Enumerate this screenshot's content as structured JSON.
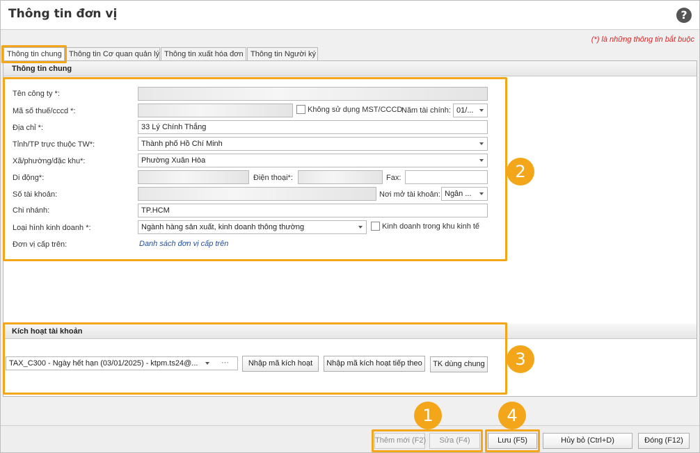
{
  "window": {
    "title": "Thông tin đơn vị",
    "help_symbol": "?"
  },
  "required_note": "(*) là những thông tin bắt buộc",
  "tabs": [
    {
      "label": "Thông tin chung",
      "active": true
    },
    {
      "label": "Thông tin Cơ quan quản lý"
    },
    {
      "label": "Thông tin xuất hóa đơn"
    },
    {
      "label": "Thông tin Người ký"
    }
  ],
  "general": {
    "section_title": "Thông tin chung",
    "company_name": {
      "label": "Tên công ty *:",
      "value": ""
    },
    "tax_code": {
      "label": "Mã số thuế/cccd *:",
      "value": ""
    },
    "no_tax_checkbox": {
      "label": "Không sử dụng MST/CCCD",
      "checked": false
    },
    "fiscal_year": {
      "label": "Năm tài chính:",
      "value": "01/..."
    },
    "address": {
      "label": "Địa chỉ *:",
      "value": "33 Lý Chính Thắng"
    },
    "province": {
      "label": "Tỉnh/TP trực thuộc TW*:",
      "value": "Thành phố Hồ Chí Minh"
    },
    "ward": {
      "label": "Xã/phường/đặc khu*:",
      "value": "Phường Xuân Hòa"
    },
    "mobile": {
      "label": "Di động*:",
      "value": ""
    },
    "phone": {
      "label": "Điện thoại*:",
      "value": ""
    },
    "fax": {
      "label": "Fax:",
      "value": ""
    },
    "account_no": {
      "label": "Số tài khoản:",
      "value": ""
    },
    "bank": {
      "label": "Nơi mở tài khoản:",
      "value": "Ngân ..."
    },
    "branch": {
      "label": "Chi nhánh:",
      "value": "TP.HCM"
    },
    "business_type": {
      "label": "Loại hình kinh doanh *:",
      "value": "Ngành hàng sản xuất, kinh doanh thông thường"
    },
    "economic_zone_checkbox": {
      "label": "Kinh doanh trong khu kinh tế",
      "checked": false
    },
    "parent_unit": {
      "label": "Đơn vị cấp trên:",
      "link": "Danh sách đơn vị cấp trên"
    }
  },
  "activation": {
    "section_title": "Kích hoạt tài khoản",
    "account_select": "TAX_C300 - Ngày hết hạn (03/01/2025) - ktpm.ts24@...",
    "more_label": "···",
    "enter_code_button": "Nhập mã kích hoạt",
    "enter_next_code_button": "Nhập mã kích hoạt tiếp theo",
    "shared_account_button": "TK dùng chung"
  },
  "footer": {
    "add_new": "Thêm mới (F2)",
    "edit": "Sửa (F4)",
    "save": "Lưu (F5)",
    "cancel": "Hủy bỏ (Ctrl+D)",
    "close": "Đóng (F12)"
  },
  "badges": [
    "1",
    "2",
    "3",
    "4"
  ],
  "colors": {
    "highlight": "#f3a619",
    "required": "#e02020",
    "link": "#1f4ea0"
  }
}
